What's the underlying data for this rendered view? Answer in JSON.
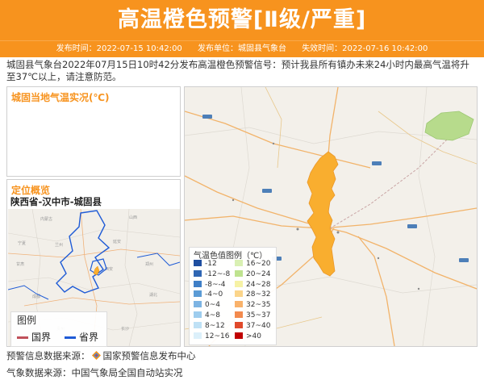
{
  "header": {
    "title": "高温橙色预警[Ⅱ级/严重]",
    "issue_time": "发布时间：2022-07-15 10:42:00",
    "issuer": "发布单位：城固县气象台",
    "expire_time": "失效时间：2022-07-16 10:42:00"
  },
  "description": "城固县气象台2022年07月15日10时42分发布高温橙色预警信号：预计我县所有镇办未来24小时内最高气温将升至37℃以上，请注意防范。",
  "temp_panel": {
    "title": "城固当地气温实况(℃)"
  },
  "location_panel": {
    "title": "定位概览",
    "location": "陕西省-汉中市-城固县",
    "legend_title": "图例",
    "legend_items": [
      "国界",
      "省界"
    ]
  },
  "map_legend": {
    "title": "气温色值图例（℃）",
    "left": [
      "-12",
      "-12~-8",
      "-8~-4",
      "-4~0",
      "0~4",
      "4~8",
      "8~12",
      "12~16"
    ],
    "right": [
      "16~20",
      "20~24",
      "24~28",
      "28~32",
      "32~35",
      "35~37",
      "37~40",
      ">40"
    ],
    "left_colors": [
      "#1f4fa0",
      "#2f66b3",
      "#3f7fc6",
      "#5b9bd5",
      "#7db4e3",
      "#9ecdee",
      "#bfe1f5",
      "#dcf0fa"
    ],
    "right_colors": [
      "#d9f0b3",
      "#bfe38f",
      "#f6f2a5",
      "#fbd58a",
      "#f9b26a",
      "#f38a4d",
      "#e0492a",
      "#c00000"
    ]
  },
  "sources": {
    "warning_source": "预警信息数据来源：",
    "warning_center": "国家预警信息发布中心",
    "weather_source": "气象数据来源：中国气象局全国自动站实况"
  },
  "colors": {
    "accent": "#f7931e",
    "highlight_region": "#f9ae2f"
  }
}
